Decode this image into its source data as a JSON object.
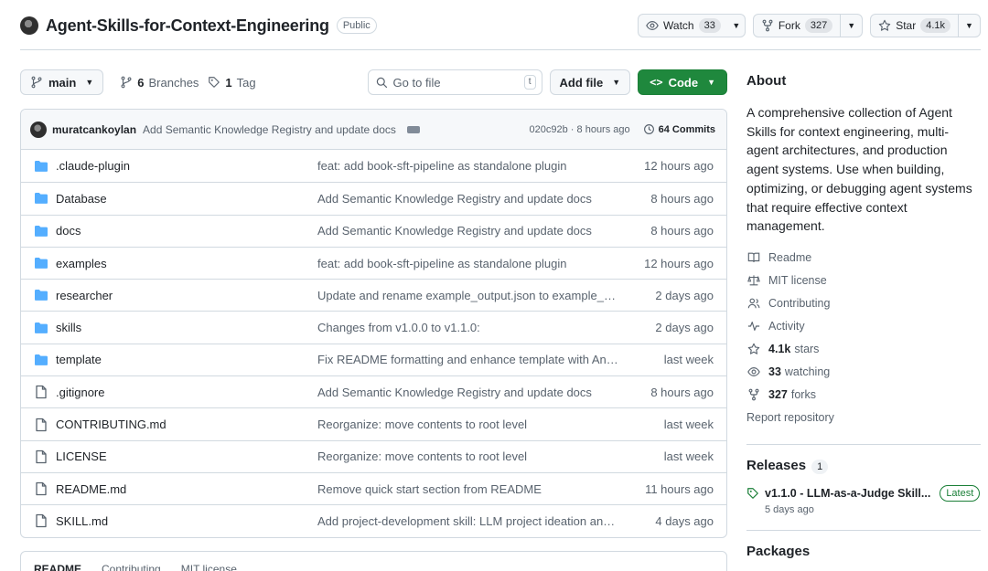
{
  "repo": {
    "name": "Agent-Skills-for-Context-Engineering",
    "visibility": "Public"
  },
  "actions": {
    "watch": {
      "label": "Watch",
      "count": "33"
    },
    "fork": {
      "label": "Fork",
      "count": "327"
    },
    "star": {
      "label": "Star",
      "count": "4.1k"
    }
  },
  "toolbar": {
    "branch": "main",
    "branches_count": "6",
    "branches_label": "Branches",
    "tags_count": "1",
    "tags_label": "Tag",
    "search_placeholder": "Go to file",
    "search_shortcut": "t",
    "add_file": "Add file",
    "code": "Code"
  },
  "commit": {
    "author": "muratcankoylan",
    "message": "Add Semantic Knowledge Registry and update docs",
    "meta": "020c92b · 8 hours ago",
    "commits_label": "64 Commits"
  },
  "files": [
    {
      "type": "dir",
      "name": ".claude-plugin",
      "message": "feat: add book-sft-pipeline as standalone plugin",
      "time": "12 hours ago"
    },
    {
      "type": "dir",
      "name": "Database",
      "message": "Add Semantic Knowledge Registry and update docs",
      "time": "8 hours ago"
    },
    {
      "type": "dir",
      "name": "docs",
      "message": "Add Semantic Knowledge Registry and update docs",
      "time": "8 hours ago"
    },
    {
      "type": "dir",
      "name": "examples",
      "message": "feat: add book-sft-pipeline as standalone plugin",
      "time": "12 hours ago"
    },
    {
      "type": "dir",
      "name": "researcher",
      "message": "Update and rename example_output.json to example_out...",
      "time": "2 days ago"
    },
    {
      "type": "dir",
      "name": "skills",
      "message": "Changes from v1.0.0 to v1.1.0:",
      "time": "2 days ago"
    },
    {
      "type": "dir",
      "name": "template",
      "message": "Fix README formatting and enhance template with Anthr...",
      "time": "last week"
    },
    {
      "type": "file",
      "name": ".gitignore",
      "message": "Add Semantic Knowledge Registry and update docs",
      "time": "8 hours ago"
    },
    {
      "type": "file",
      "name": "CONTRIBUTING.md",
      "message": "Reorganize: move contents to root level",
      "time": "last week"
    },
    {
      "type": "file",
      "name": "LICENSE",
      "message": "Reorganize: move contents to root level",
      "time": "last week"
    },
    {
      "type": "file",
      "name": "README.md",
      "message": "Remove quick start section from README",
      "time": "11 hours ago"
    },
    {
      "type": "file",
      "name": "SKILL.md",
      "message": "Add project-development skill: LLM project ideation and ...",
      "time": "4 days ago"
    }
  ],
  "readme_tabs": {
    "readme": "README",
    "contributing": "Contributing",
    "license": "MIT license"
  },
  "about": {
    "heading": "About",
    "description": "A comprehensive collection of Agent Skills for context engineering, multi-agent architectures, and production agent systems. Use when building, optimizing, or debugging agent systems that require effective context management.",
    "links": [
      {
        "icon": "book-icon",
        "bold": "",
        "text": "Readme"
      },
      {
        "icon": "scale-icon",
        "bold": "",
        "text": "MIT license"
      },
      {
        "icon": "people-icon",
        "bold": "",
        "text": "Contributing"
      },
      {
        "icon": "pulse-icon",
        "bold": "",
        "text": "Activity"
      },
      {
        "icon": "star-icon",
        "bold": "4.1k",
        "text": "stars"
      },
      {
        "icon": "eye-icon",
        "bold": "33",
        "text": "watching"
      },
      {
        "icon": "fork-icon",
        "bold": "327",
        "text": "forks"
      }
    ],
    "report": "Report repository"
  },
  "releases": {
    "heading": "Releases",
    "count": "1",
    "latest": {
      "name": "v1.1.0 - LLM-as-a-Judge Skill...",
      "badge": "Latest",
      "date": "5 days ago"
    }
  },
  "packages": {
    "heading": "Packages"
  },
  "colors": {
    "accent_green": "#1f883d",
    "folder_blue": "#54aeff",
    "muted": "#59636e",
    "border": "#d1d9e0"
  }
}
